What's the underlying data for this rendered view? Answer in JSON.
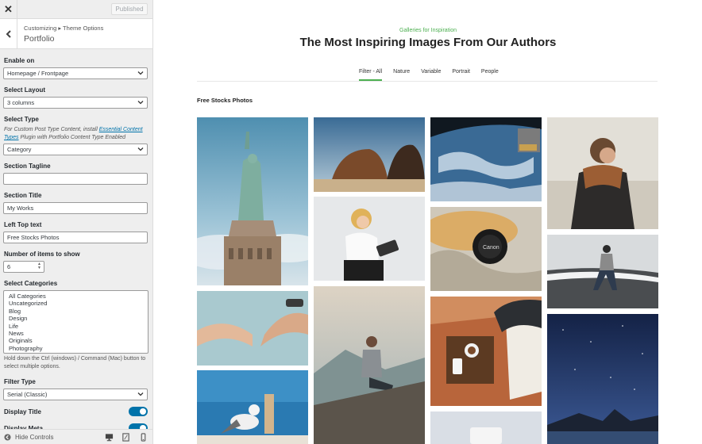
{
  "topbar": {
    "close_glyph": "✕",
    "published_label": "Published"
  },
  "panel": {
    "breadcrumb": "Customizing ▸ Theme Options",
    "title": "Portfolio"
  },
  "controls": {
    "enable_on": {
      "label": "Enable on",
      "value": "Homepage / Frontpage"
    },
    "select_layout": {
      "label": "Select Layout",
      "value": "3 columns"
    },
    "select_type": {
      "label": "Select Type",
      "desc_before": "For Custom Post Type Content, install ",
      "desc_link": "Essential Content Types",
      "desc_after": " Plugin with Portfolio Content Type Enabled",
      "value": "Category"
    },
    "section_tagline": {
      "label": "Section Tagline",
      "value": ""
    },
    "section_title": {
      "label": "Section Title",
      "value": "My Works"
    },
    "left_top_text": {
      "label": "Left Top text",
      "value": "Free Stocks Photos"
    },
    "items_to_show": {
      "label": "Number of items to show",
      "value": "6"
    },
    "select_categories": {
      "label": "Select Categories",
      "options": [
        "All Categories",
        "Uncategorized",
        "Blog",
        "Design",
        "Life",
        "News",
        "Originals",
        "Photography"
      ],
      "help": "Hold down the Ctrl (windows) / Command (Mac) button to select multiple options."
    },
    "filter_type": {
      "label": "Filter Type",
      "value": "Serial (Classic)"
    },
    "display_title": {
      "label": "Display Title",
      "on": true
    },
    "display_meta": {
      "label": "Display Meta",
      "on": true
    }
  },
  "footer": {
    "hide_label": "Hide Controls",
    "devices": [
      "desktop-icon",
      "tablet-icon",
      "mobile-icon"
    ]
  },
  "preview": {
    "tagline": "Galleries for Inspiration",
    "headline": "The Most Inspiring Images From Our Authors",
    "tabs": [
      "Filter - All",
      "Nature",
      "Variable",
      "Portrait",
      "People"
    ],
    "active_tab": 0,
    "left_top": "Free Stocks Photos"
  },
  "colors": {
    "accent": "#0073aa",
    "tagline": "#4caf50",
    "sidebar_bg": "#eeeeee"
  }
}
